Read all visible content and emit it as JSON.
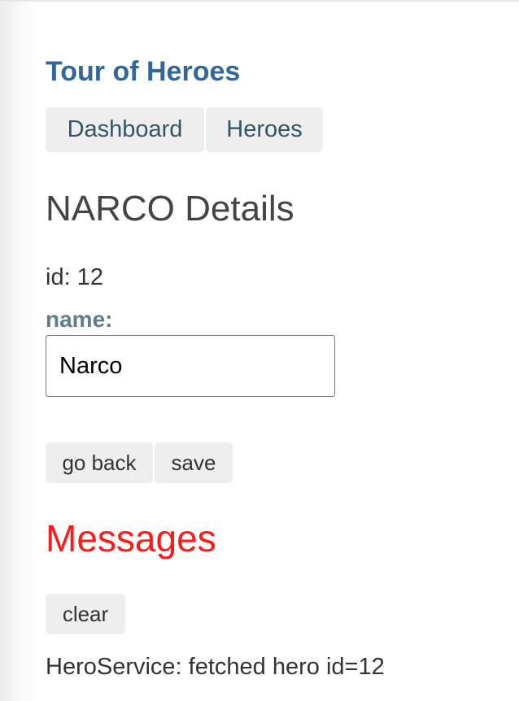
{
  "app": {
    "title": "Tour of Heroes"
  },
  "nav": {
    "items": [
      {
        "label": "Dashboard"
      },
      {
        "label": "Heroes"
      }
    ]
  },
  "hero_detail": {
    "title": "NARCO Details",
    "id_text": "id: 12",
    "name_label": "name:",
    "name_value": "Narco",
    "go_back_label": "go back",
    "save_label": "save"
  },
  "messages": {
    "title": "Messages",
    "clear_label": "clear",
    "items": [
      "HeroService: fetched hero id=12"
    ]
  },
  "colors": {
    "app_title": "#336699",
    "messages_title": "#ff1a1a",
    "name_label": "#607d8b",
    "button_bg": "#eeeeee"
  }
}
